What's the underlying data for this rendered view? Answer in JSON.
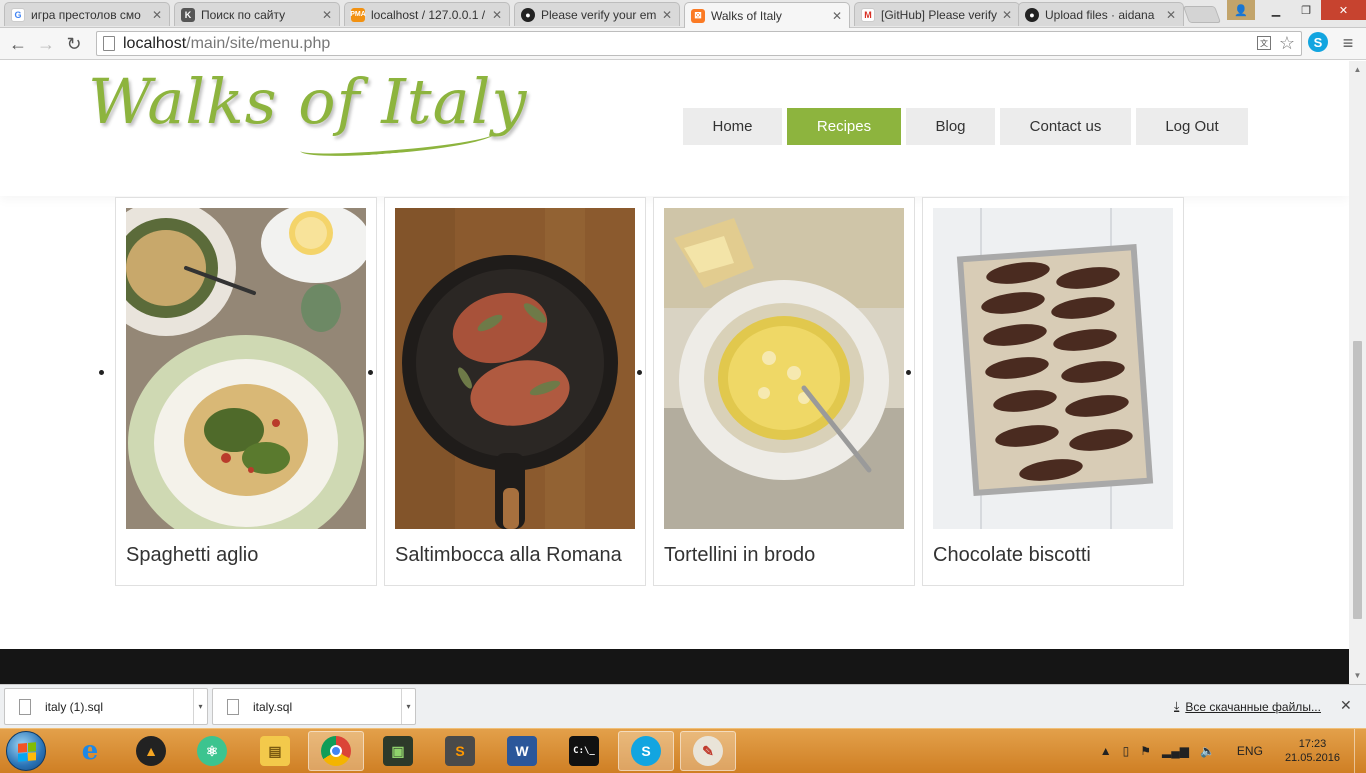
{
  "browser": {
    "tabs": [
      {
        "title": "игра престолов смо",
        "icon": "google-icon",
        "icon_color": "#4285f4",
        "active": false
      },
      {
        "title": "Поиск по сайту",
        "icon": "kinopoisk-icon",
        "icon_color": "#555555",
        "active": false
      },
      {
        "title": "localhost / 127.0.0.1 /",
        "icon": "phpmyadmin-icon",
        "icon_color": "#f29111",
        "active": false
      },
      {
        "title": "Please verify your em",
        "icon": "github-icon",
        "icon_color": "#222222",
        "active": false
      },
      {
        "title": "Walks of Italy",
        "icon": "xampp-icon",
        "icon_color": "#fb7a24",
        "active": true
      },
      {
        "title": "[GitHub] Please verify",
        "icon": "gmail-icon",
        "icon_color": "#d93025",
        "active": false
      },
      {
        "title": "Upload files · aidana",
        "icon": "github-icon",
        "icon_color": "#222222",
        "active": false
      }
    ],
    "url_host": "localhost",
    "url_path": "/main/site/menu.php"
  },
  "site": {
    "logo": "Walks of Italy",
    "accent_color": "#8db43e",
    "nav": [
      {
        "label": "Home",
        "active": false
      },
      {
        "label": "Recipes",
        "active": true
      },
      {
        "label": "Blog",
        "active": false
      },
      {
        "label": "Contact us",
        "active": false
      },
      {
        "label": "Log Out",
        "active": false
      }
    ],
    "recipes": [
      {
        "title": "Spaghetti aglio",
        "image": "spaghetti-photo"
      },
      {
        "title": "Saltimbocca alla Romana",
        "image": "saltimbocca-photo"
      },
      {
        "title": "Tortellini in brodo",
        "image": "tortellini-photo"
      },
      {
        "title": "Chocolate biscotti",
        "image": "biscotti-photo"
      }
    ]
  },
  "downloads": {
    "items": [
      {
        "filename": "italy (1).sql"
      },
      {
        "filename": "italy.sql"
      }
    ],
    "show_all": "Все скачанные файлы..."
  },
  "taskbar": {
    "apps": [
      {
        "name": "internet-explorer-icon",
        "running": false
      },
      {
        "name": "aimp-icon",
        "running": false
      },
      {
        "name": "atom-icon",
        "running": false
      },
      {
        "name": "file-explorer-icon",
        "running": false
      },
      {
        "name": "chrome-icon",
        "running": true
      },
      {
        "name": "terminal-ide-icon",
        "running": false
      },
      {
        "name": "sublime-text-icon",
        "running": false
      },
      {
        "name": "word-icon",
        "running": false
      },
      {
        "name": "command-prompt-icon",
        "running": false
      },
      {
        "name": "skype-icon",
        "running": true
      },
      {
        "name": "paint-icon",
        "running": true
      }
    ],
    "language": "ENG",
    "time": "17:23",
    "date": "21.05.2016"
  }
}
